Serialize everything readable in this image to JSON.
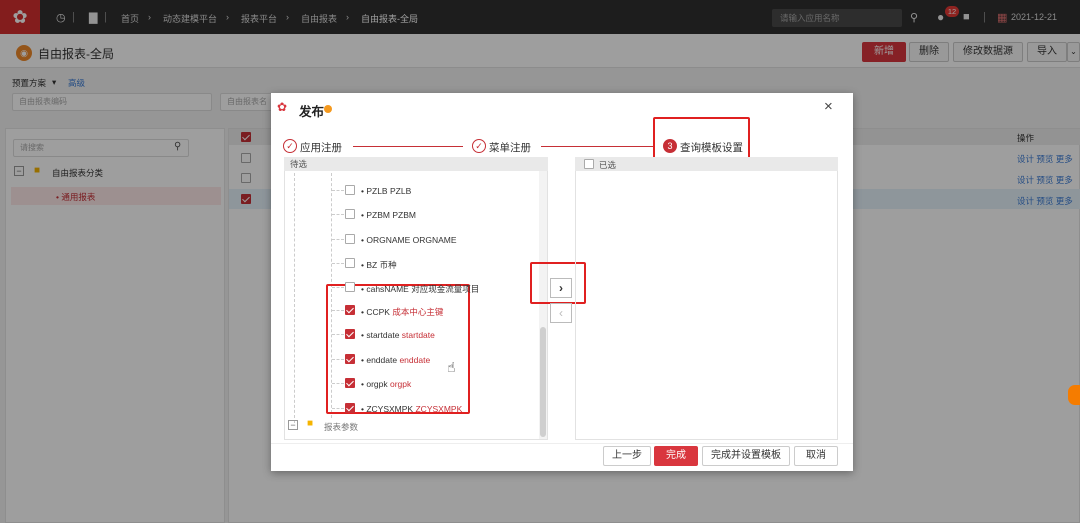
{
  "topbar": {
    "breadcrumb": [
      "首页",
      "动态建模平台",
      "报表平台",
      "自由报表",
      "自由报表-全局"
    ],
    "search_placeholder": "请输入应用名称",
    "notification_count": "12",
    "date": "2021-12-21"
  },
  "page": {
    "title": "自由报表-全局",
    "buttons": [
      "新增",
      "删除",
      "修改数据源",
      "导入"
    ]
  },
  "filter": {
    "scheme_label": "预置方案",
    "advanced_label": "高级",
    "code_placeholder": "自由报表编码",
    "name_placeholder": "自由报表名"
  },
  "tree": {
    "search_placeholder": "请搜索",
    "root": "自由报表分类",
    "child": "通用报表"
  },
  "table": {
    "op_header": "操作",
    "row_ops": [
      "设计 预览 更多",
      "设计 预览 更多",
      "设计 预览 更多"
    ]
  },
  "modal": {
    "title": "发布",
    "steps": [
      {
        "num": "✓",
        "label": "应用注册"
      },
      {
        "num": "✓",
        "label": "菜单注册"
      },
      {
        "num": "3",
        "label": "查询模板设置"
      }
    ],
    "left_header": "待选",
    "right_header": "已选",
    "items": [
      {
        "code": "PZLB",
        "name": "PZLB",
        "checked": false
      },
      {
        "code": "PZBM",
        "name": "PZBM",
        "checked": false
      },
      {
        "code": "ORGNAME",
        "name": "ORGNAME",
        "checked": false
      },
      {
        "code": "BZ",
        "name": "币种",
        "checked": false
      },
      {
        "code": "cahsNAME",
        "name": "对应现金流量项目",
        "checked": false
      },
      {
        "code": "CCPK",
        "name": "成本中心主键",
        "checked": true
      },
      {
        "code": "startdate",
        "name": "startdate",
        "checked": true
      },
      {
        "code": "enddate",
        "name": "enddate",
        "checked": true
      },
      {
        "code": "orgpk",
        "name": "orgpk",
        "checked": true
      },
      {
        "code": "ZCYSXMPK",
        "name": "ZCYSXMPK",
        "checked": true
      }
    ],
    "folder_label": "报表参数",
    "move_right": "›",
    "move_left": "‹",
    "footer_buttons": [
      "上一步",
      "完成",
      "完成并设置模板",
      "取消"
    ]
  }
}
